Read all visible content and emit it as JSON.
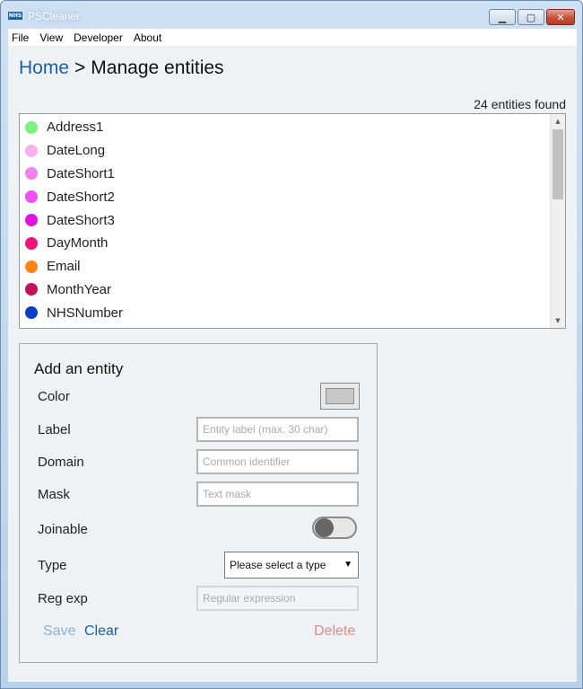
{
  "window": {
    "title": "PSCleaner",
    "icon_text": "NHS",
    "controls": {
      "minimize": "▁",
      "maximize": "▢",
      "close": "✕"
    }
  },
  "menu": [
    "File",
    "View",
    "Developer",
    "About"
  ],
  "breadcrumb": {
    "home": "Home",
    "separator": ">",
    "current": "Manage entities"
  },
  "entities_count_text": "24 entities found",
  "entities": [
    {
      "label": "Address1",
      "color": "#7ef07e"
    },
    {
      "label": "DateLong",
      "color": "#f7b0f0"
    },
    {
      "label": "DateShort1",
      "color": "#f37ff0"
    },
    {
      "label": "DateShort2",
      "color": "#f050ef"
    },
    {
      "label": "DateShort3",
      "color": "#e014e0"
    },
    {
      "label": "DayMonth",
      "color": "#f0137a"
    },
    {
      "label": "Email",
      "color": "#ff8512"
    },
    {
      "label": "MonthYear",
      "color": "#c7125a"
    },
    {
      "label": "NHSNumber",
      "color": "#0b3fc7"
    }
  ],
  "form": {
    "title": "Add an entity",
    "labels": {
      "color": "Color",
      "label": "Label",
      "domain": "Domain",
      "mask": "Mask",
      "joinable": "Joinable",
      "type": "Type",
      "regexp": "Reg exp"
    },
    "color_value": "#c8c8c8",
    "joinable_on": false,
    "placeholders": {
      "label": "Entity label (max. 30 char)",
      "domain": "Common identifier",
      "mask": "Text mask",
      "regexp": "Regular expression"
    },
    "type_select": "Please select a type",
    "buttons": {
      "save": "Save",
      "clear": "Clear",
      "delete": "Delete"
    }
  }
}
